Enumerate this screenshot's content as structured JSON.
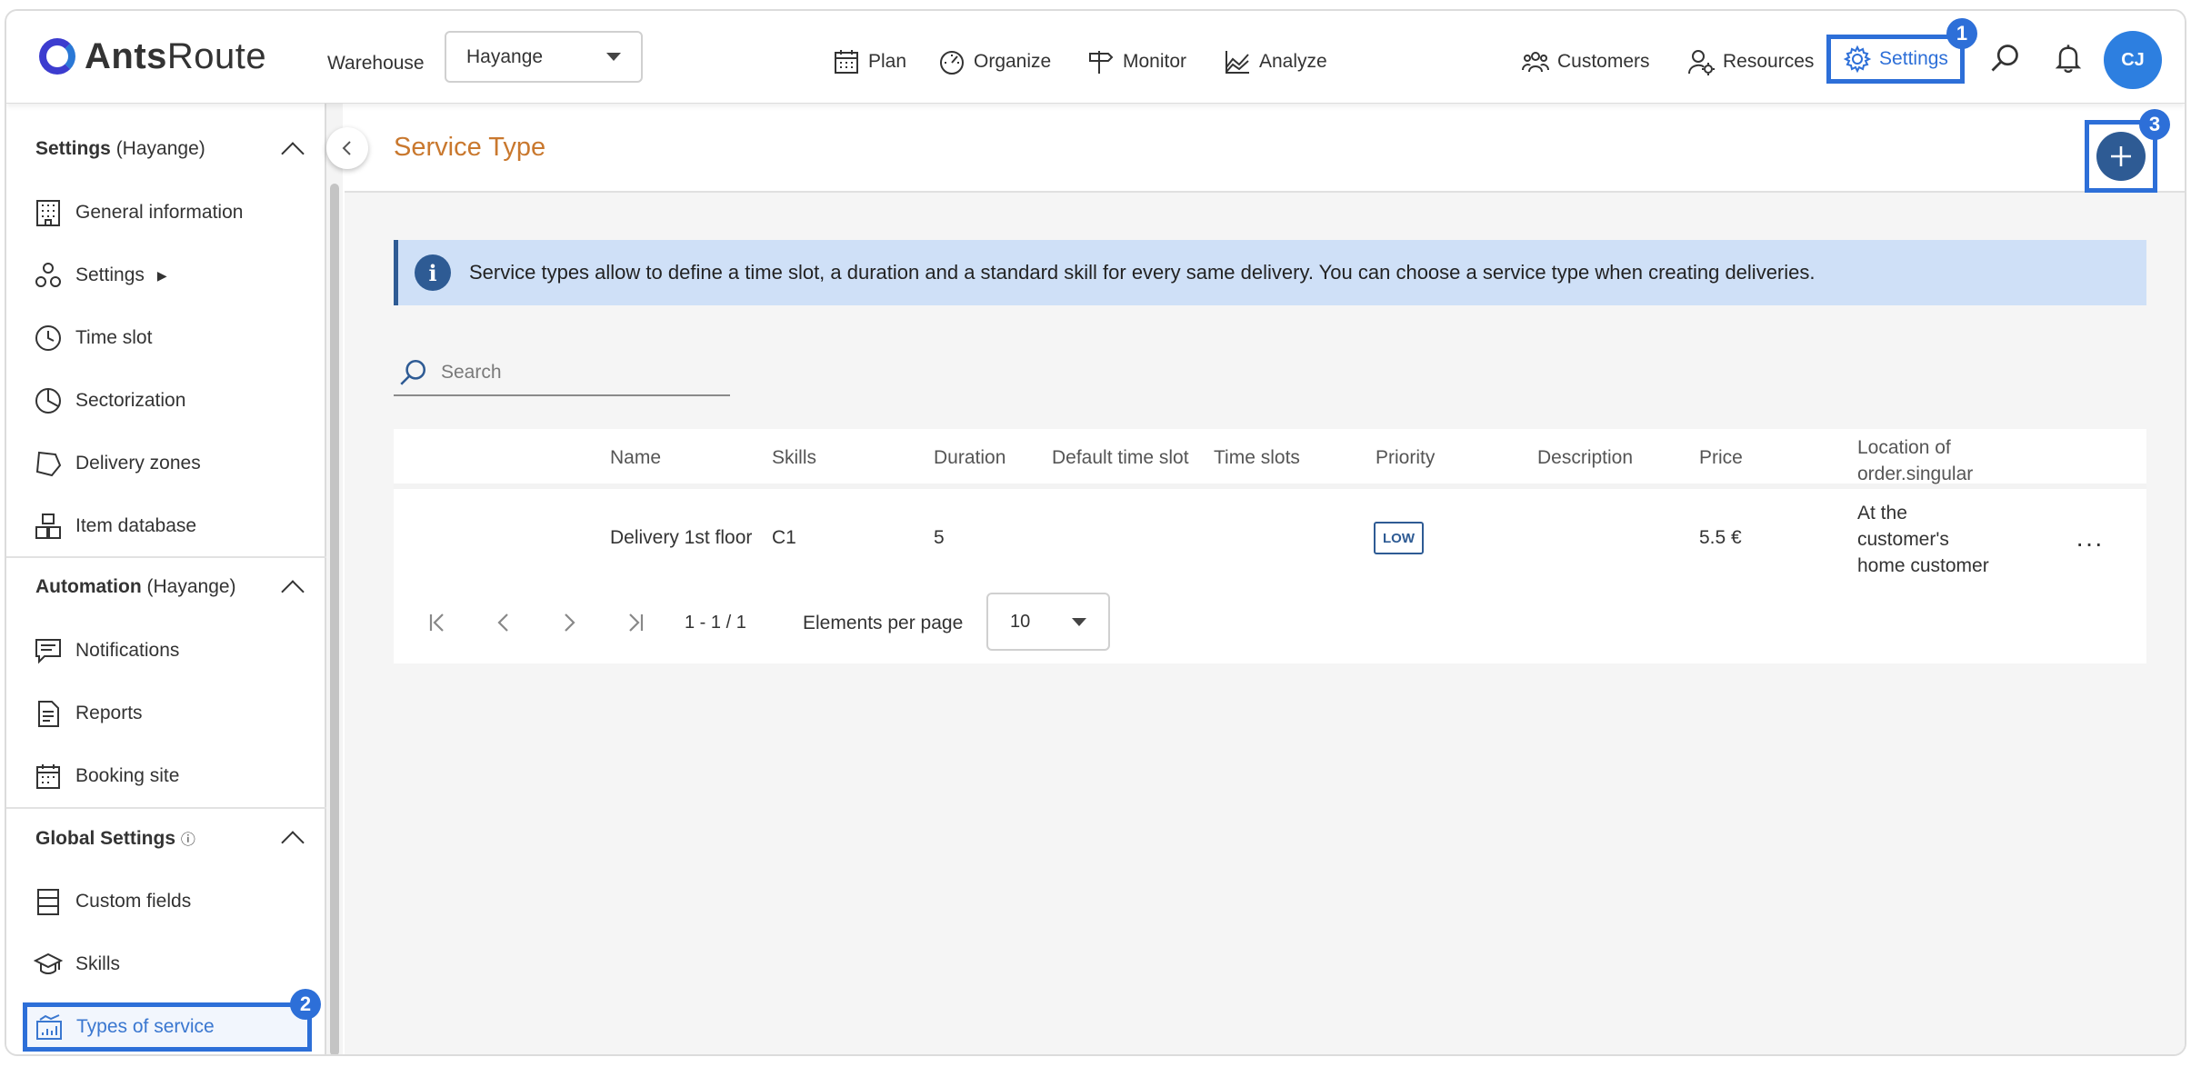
{
  "app": {
    "logo_bold": "Ants",
    "logo_light": "Route"
  },
  "topbar": {
    "warehouse_label": "Warehouse",
    "warehouse_value": "Hayange",
    "nav": {
      "plan": "Plan",
      "organize": "Organize",
      "monitor": "Monitor",
      "analyze": "Analyze",
      "customers": "Customers",
      "resources": "Resources",
      "settings": "Settings"
    },
    "avatar_initials": "CJ"
  },
  "annotations": {
    "badge_1": "1",
    "badge_2": "2",
    "badge_3": "3"
  },
  "sidebar": {
    "settings_section": {
      "title": "Settings",
      "suffix": "(Hayange)"
    },
    "settings_items": [
      {
        "label": "General information",
        "icon": "building-icon"
      },
      {
        "label": "Settings",
        "icon": "shapes-icon",
        "arrow": "▶"
      },
      {
        "label": "Time slot",
        "icon": "clock-icon"
      },
      {
        "label": "Sectorization",
        "icon": "pie-icon"
      },
      {
        "label": "Delivery zones",
        "icon": "polygon-icon"
      },
      {
        "label": "Item database",
        "icon": "boxes-icon"
      }
    ],
    "automation_section": {
      "title": "Automation",
      "suffix": "(Hayange)"
    },
    "automation_items": [
      {
        "label": "Notifications",
        "icon": "message-icon"
      },
      {
        "label": "Reports",
        "icon": "document-icon"
      },
      {
        "label": "Booking site",
        "icon": "calendar-icon"
      }
    ],
    "global_section": {
      "title": "Global Settings",
      "info": "ⓘ"
    },
    "global_items": [
      {
        "label": "Custom fields",
        "icon": "rows-icon"
      },
      {
        "label": "Skills",
        "icon": "graduation-icon"
      },
      {
        "label": "Types of service",
        "icon": "chart-icon",
        "active": true
      }
    ]
  },
  "page": {
    "title": "Service Type",
    "info_text": "Service types allow to define a time slot, a duration and a standard skill for every same delivery. You can choose a service type when creating deliveries.",
    "search_placeholder": "Search",
    "table": {
      "headers": {
        "name": "Name",
        "skills": "Skills",
        "duration": "Duration",
        "default_time_slot": "Default time slot",
        "time_slots": "Time slots",
        "priority": "Priority",
        "description": "Description",
        "price": "Price",
        "location_line1": "Location of",
        "location_line2": "order.singular"
      },
      "rows": [
        {
          "name": "Delivery 1st floor",
          "skills": "C1",
          "duration": "5",
          "default_time_slot": "",
          "time_slots": "",
          "priority": "LOW",
          "description": "",
          "price": "5.5 €",
          "location_line1": "At the",
          "location_line2": "customer's",
          "location_line3": "home customer",
          "more": "···"
        }
      ]
    },
    "pagination": {
      "range": "1 - 1 / 1",
      "per_page_label": "Elements per page",
      "per_page_value": "10"
    }
  },
  "colors": {
    "accent_blue": "#2d6fd8",
    "dark_blue": "#2e5b94",
    "title_orange": "#c9782e",
    "info_bg": "#cfe0f7"
  }
}
